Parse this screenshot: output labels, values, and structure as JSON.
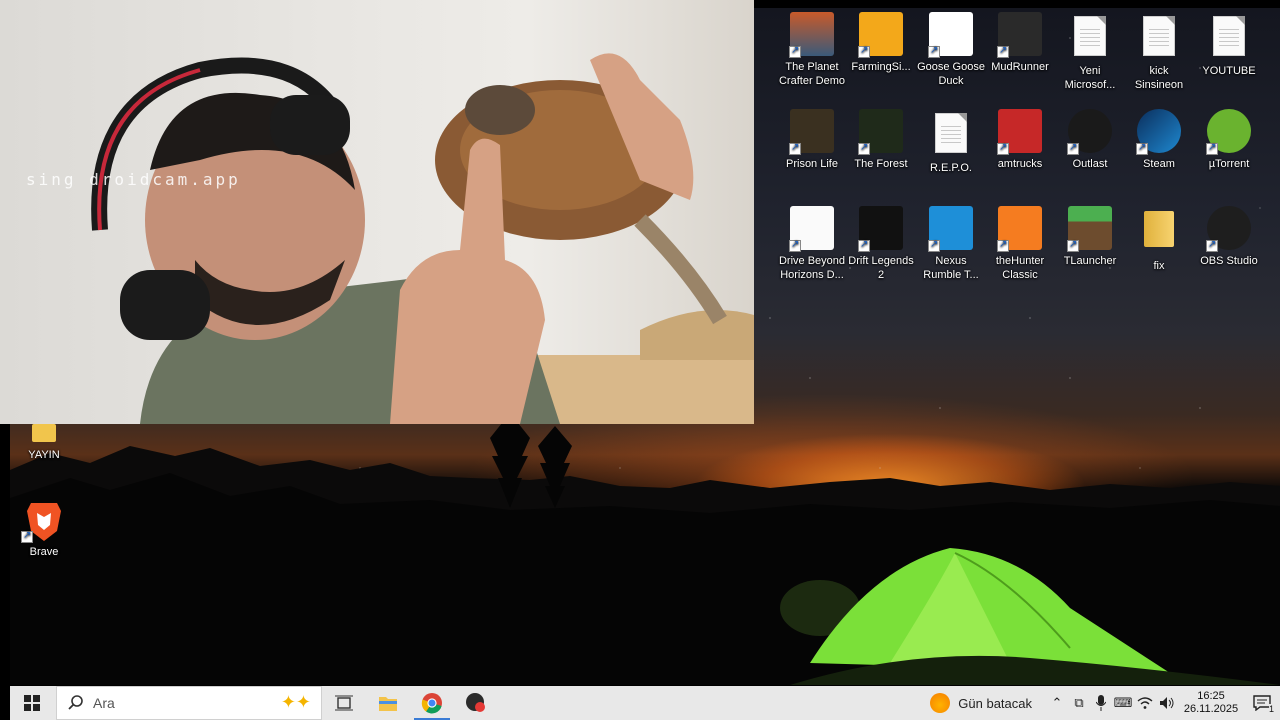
{
  "webcam": {
    "watermark": "sing droidcam.app"
  },
  "desktop_icons": [
    {
      "label": "The Planet Crafter Demo",
      "icon": "planet-crafter-icon"
    },
    {
      "label": "FarmingSi...",
      "icon": "farming-simulator-icon"
    },
    {
      "label": "Goose Goose Duck",
      "icon": "goose-icon"
    },
    {
      "label": "MudRunner",
      "icon": "mudrunner-truck-icon"
    },
    {
      "label": "Yeni Microsof...",
      "icon": "document-icon"
    },
    {
      "label": "kick Sinsineon",
      "icon": "document-icon"
    },
    {
      "label": "YOUTUBE",
      "icon": "document-icon"
    },
    {
      "label": "Prison Life",
      "icon": "prison-life-icon"
    },
    {
      "label": "The Forest",
      "icon": "the-forest-icon"
    },
    {
      "label": "R.E.P.O.",
      "icon": "document-icon"
    },
    {
      "label": "amtrucks",
      "icon": "truck-icon"
    },
    {
      "label": "Outlast",
      "icon": "outlast-icon"
    },
    {
      "label": "Steam",
      "icon": "steam-icon"
    },
    {
      "label": "µTorrent",
      "icon": "utorrent-icon"
    },
    {
      "label": "Drive Beyond Horizons D...",
      "icon": "drive-beyond-horizons-icon"
    },
    {
      "label": "Drift Legends 2",
      "icon": "drift-legends-icon"
    },
    {
      "label": "Nexus Rumble T...",
      "icon": "nexus-rumble-icon"
    },
    {
      "label": "theHunter Classic",
      "icon": "thehunter-icon"
    },
    {
      "label": "TLauncher",
      "icon": "tlauncher-icon"
    },
    {
      "label": "fix",
      "icon": "folder-icon"
    },
    {
      "label": "OBS Studio",
      "icon": "obs-icon"
    },
    {
      "label": "YAYIN",
      "icon": "folder-icon"
    },
    {
      "label": "Brave",
      "icon": "brave-icon"
    }
  ],
  "taskbar": {
    "search_placeholder": "Ara",
    "weather_text": "Gün batacak",
    "time": "16:25",
    "date": "26.11.2025"
  },
  "colors": {
    "taskbar_bg": "#e8e8e8",
    "accent": "#3a7bd5"
  }
}
